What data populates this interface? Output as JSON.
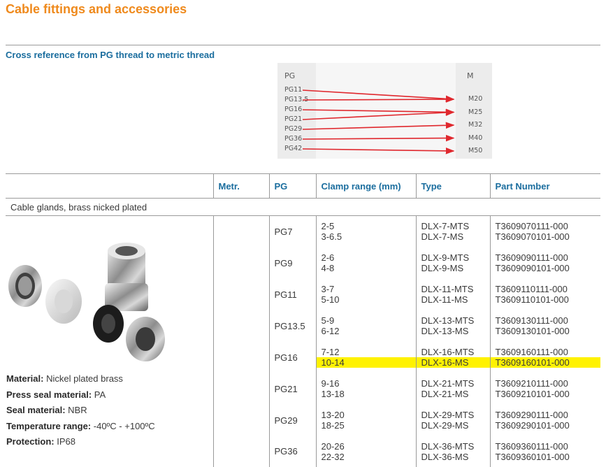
{
  "page": {
    "title": "Cable fittings and accessories",
    "subtitle": "Cross reference from PG thread to metric thread"
  },
  "xref": {
    "pg_header": "PG",
    "m_header": "M",
    "pg_items": [
      "PG11",
      "PG13.5",
      "PG16",
      "PG21",
      "PG29",
      "PG36",
      "PG42"
    ],
    "m_items": [
      "M20",
      "M25",
      "M32",
      "M40",
      "M50"
    ],
    "arrow_color": "#e0282e",
    "mapping": [
      {
        "pg": "PG11",
        "m": "M20"
      },
      {
        "pg": "PG13.5",
        "m": "M20"
      },
      {
        "pg": "PG16",
        "m": "M25"
      },
      {
        "pg": "PG21",
        "m": "M25"
      },
      {
        "pg": "PG29",
        "m": "M32"
      },
      {
        "pg": "PG36",
        "m": "M40"
      },
      {
        "pg": "PG42",
        "m": "M50"
      }
    ]
  },
  "table": {
    "headers": {
      "metr": "Metr.",
      "pg": "PG",
      "clamp": "Clamp range (mm)",
      "type": "Type",
      "part": "Part Number"
    },
    "section": "Cable glands, brass nicked plated",
    "specs": {
      "material_label": "Material:",
      "material_value": "Nickel plated brass",
      "press_seal_label": "Press seal material:",
      "press_seal_value": "PA",
      "seal_label": "Seal material:",
      "seal_value": "NBR",
      "temp_label": "Temperature range:",
      "temp_value": "-40ºC - +100ºC",
      "protection_label": "Protection:",
      "protection_value": "IP68"
    },
    "rows": [
      {
        "pg": "PG7",
        "clamp": [
          "2-5",
          "3-6.5"
        ],
        "type": [
          "DLX-7-MTS",
          "DLX-7-MS"
        ],
        "part": [
          "T3609070111-000",
          "T3609070101-000"
        ]
      },
      {
        "pg": "PG9",
        "clamp": [
          "2-6",
          "4-8"
        ],
        "type": [
          "DLX-9-MTS",
          "DLX-9-MS"
        ],
        "part": [
          "T3609090111-000",
          "T3609090101-000"
        ]
      },
      {
        "pg": "PG11",
        "clamp": [
          "3-7",
          "5-10"
        ],
        "type": [
          "DLX-11-MTS",
          "DLX-11-MS"
        ],
        "part": [
          "T3609110111-000",
          "T3609110101-000"
        ]
      },
      {
        "pg": "PG13.5",
        "clamp": [
          "5-9",
          "6-12"
        ],
        "type": [
          "DLX-13-MTS",
          "DLX-13-MS"
        ],
        "part": [
          "T3609130111-000",
          "T3609130101-000"
        ]
      },
      {
        "pg": "PG16",
        "clamp": [
          "7-12",
          "10-14"
        ],
        "type": [
          "DLX-16-MTS",
          "DLX-16-MS"
        ],
        "part": [
          "T3609160111-000",
          "T3609160101-000"
        ]
      },
      {
        "pg": "PG21",
        "clamp": [
          "9-16",
          "13-18"
        ],
        "type": [
          "DLX-21-MTS",
          "DLX-21-MS"
        ],
        "part": [
          "T3609210111-000",
          "T3609210101-000"
        ]
      },
      {
        "pg": "PG29",
        "clamp": [
          "13-20",
          "18-25"
        ],
        "type": [
          "DLX-29-MTS",
          "DLX-29-MS"
        ],
        "part": [
          "T3609290111-000",
          "T3609290101-000"
        ]
      },
      {
        "pg": "PG36",
        "clamp": [
          "20-26",
          "22-32"
        ],
        "type": [
          "DLX-36-MTS",
          "DLX-36-MS"
        ],
        "part": [
          "T3609360111-000",
          "T3609360101-000"
        ]
      }
    ],
    "highlight_color": "#fff200"
  }
}
